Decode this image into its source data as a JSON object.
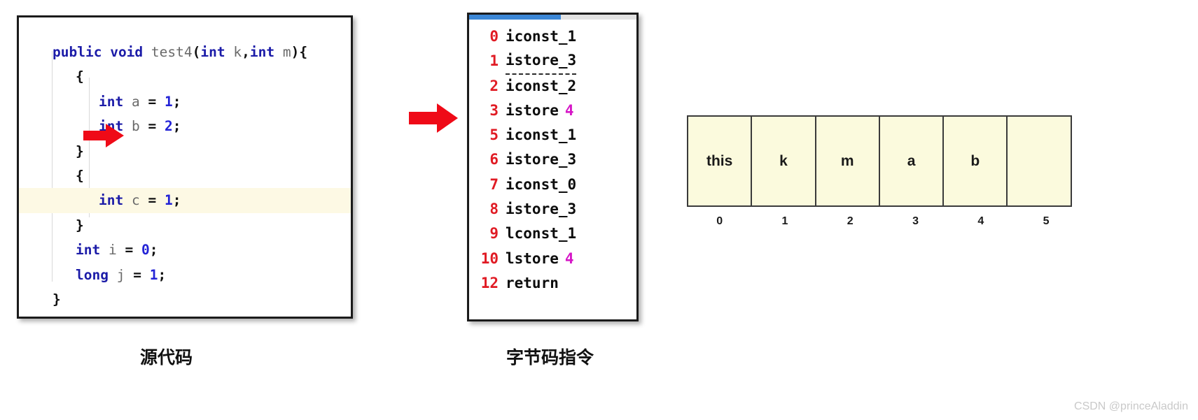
{
  "source_panel": {
    "language": "java",
    "highlighted_line_index": 6,
    "arrow_line_index": 3,
    "lines": [
      {
        "indent": 0,
        "tokens": [
          {
            "t": "public",
            "c": "kw"
          },
          {
            "t": " ",
            "c": "pun"
          },
          {
            "t": "void",
            "c": "kw"
          },
          {
            "t": " ",
            "c": "pun"
          },
          {
            "t": "test4",
            "c": "id"
          },
          {
            "t": "(",
            "c": "pun"
          },
          {
            "t": "int",
            "c": "kw"
          },
          {
            "t": " ",
            "c": "pun"
          },
          {
            "t": "k",
            "c": "id"
          },
          {
            "t": ",",
            "c": "pun"
          },
          {
            "t": "int",
            "c": "kw"
          },
          {
            "t": " ",
            "c": "pun"
          },
          {
            "t": "m",
            "c": "id"
          },
          {
            "t": ")",
            "c": "pun"
          },
          {
            "t": "{",
            "c": "brc"
          }
        ]
      },
      {
        "indent": 1,
        "tokens": [
          {
            "t": "{",
            "c": "brc"
          }
        ]
      },
      {
        "indent": 2,
        "tokens": [
          {
            "t": "int",
            "c": "kw"
          },
          {
            "t": " ",
            "c": "pun"
          },
          {
            "t": "a",
            "c": "id"
          },
          {
            "t": " ",
            "c": "pun"
          },
          {
            "t": "=",
            "c": "pun"
          },
          {
            "t": " ",
            "c": "pun"
          },
          {
            "t": "1",
            "c": "num"
          },
          {
            "t": ";",
            "c": "pun"
          }
        ]
      },
      {
        "indent": 2,
        "tokens": [
          {
            "t": "int",
            "c": "kw"
          },
          {
            "t": " ",
            "c": "pun"
          },
          {
            "t": "b",
            "c": "id"
          },
          {
            "t": " ",
            "c": "pun"
          },
          {
            "t": "=",
            "c": "pun"
          },
          {
            "t": " ",
            "c": "pun"
          },
          {
            "t": "2",
            "c": "num"
          },
          {
            "t": ";",
            "c": "pun"
          }
        ]
      },
      {
        "indent": 1,
        "tokens": [
          {
            "t": "}",
            "c": "brc"
          }
        ]
      },
      {
        "indent": 1,
        "tokens": [
          {
            "t": "{",
            "c": "brc"
          }
        ]
      },
      {
        "indent": 2,
        "tokens": [
          {
            "t": "int",
            "c": "kw"
          },
          {
            "t": " ",
            "c": "pun"
          },
          {
            "t": "c",
            "c": "id"
          },
          {
            "t": " ",
            "c": "pun"
          },
          {
            "t": "=",
            "c": "pun"
          },
          {
            "t": " ",
            "c": "pun"
          },
          {
            "t": "1",
            "c": "num"
          },
          {
            "t": ";",
            "c": "pun"
          }
        ]
      },
      {
        "indent": 1,
        "tokens": [
          {
            "t": "}",
            "c": "brc"
          }
        ]
      },
      {
        "indent": 1,
        "tokens": [
          {
            "t": "int",
            "c": "kw"
          },
          {
            "t": " ",
            "c": "pun"
          },
          {
            "t": "i",
            "c": "id"
          },
          {
            "t": " ",
            "c": "pun"
          },
          {
            "t": "=",
            "c": "pun"
          },
          {
            "t": " ",
            "c": "pun"
          },
          {
            "t": "0",
            "c": "num"
          },
          {
            "t": ";",
            "c": "pun"
          }
        ]
      },
      {
        "indent": 1,
        "tokens": [
          {
            "t": "long",
            "c": "kw"
          },
          {
            "t": " ",
            "c": "pun"
          },
          {
            "t": "j",
            "c": "id"
          },
          {
            "t": " ",
            "c": "pun"
          },
          {
            "t": "=",
            "c": "pun"
          },
          {
            "t": " ",
            "c": "pun"
          },
          {
            "t": "1",
            "c": "num"
          },
          {
            "t": ";",
            "c": "pun"
          }
        ]
      },
      {
        "indent": 0,
        "tokens": [
          {
            "t": "}",
            "c": "brc"
          }
        ]
      }
    ]
  },
  "bytecode_panel": {
    "progress_percent": 55,
    "instructions": [
      {
        "offset": "0",
        "op": "iconst_1",
        "arg": "",
        "dashed": false
      },
      {
        "offset": "1",
        "op": "istore_3",
        "arg": "",
        "dashed": true
      },
      {
        "offset": "2",
        "op": "iconst_2",
        "arg": "",
        "dashed": false
      },
      {
        "offset": "3",
        "op": "istore",
        "arg": "4",
        "dashed": false
      },
      {
        "offset": "5",
        "op": "iconst_1",
        "arg": "",
        "dashed": false
      },
      {
        "offset": "6",
        "op": "istore_3",
        "arg": "",
        "dashed": false
      },
      {
        "offset": "7",
        "op": "iconst_0",
        "arg": "",
        "dashed": false
      },
      {
        "offset": "8",
        "op": "istore_3",
        "arg": "",
        "dashed": false
      },
      {
        "offset": "9",
        "op": "lconst_1",
        "arg": "",
        "dashed": false
      },
      {
        "offset": "10",
        "op": "lstore",
        "arg": "4",
        "dashed": false
      },
      {
        "offset": "12",
        "op": "return",
        "arg": "",
        "dashed": false
      }
    ]
  },
  "slot_table": {
    "cells": [
      "this",
      "k",
      "m",
      "a",
      "b",
      ""
    ],
    "indices": [
      "0",
      "1",
      "2",
      "3",
      "4",
      "5"
    ]
  },
  "captions": {
    "source": "源代码",
    "bytecode": "字节码指令"
  },
  "watermark": "CSDN @princeAladdin",
  "colors": {
    "arrow_red": "#ef0a17",
    "offset_red": "#e01b24",
    "arg_magenta": "#d617c7",
    "keyword_blue": "#1c1ca8",
    "number_blue": "#2323d6",
    "identifier_gray": "#6a6a6a",
    "highlight_row": "#fdf9e4",
    "slot_fill": "#fbfadd",
    "progress_blue": "#3c87d6"
  }
}
